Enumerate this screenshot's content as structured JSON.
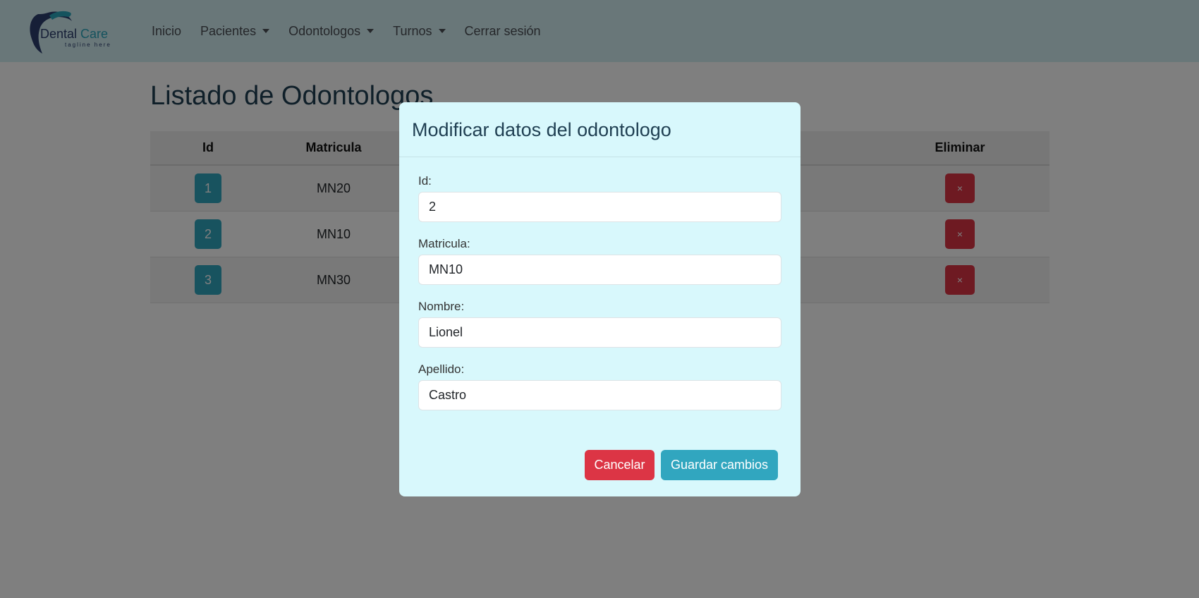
{
  "brand": {
    "name_part1": "Dental",
    "name_part2": "Care",
    "tagline": "tagline here"
  },
  "nav": {
    "items": [
      {
        "label": "Inicio",
        "dropdown": false
      },
      {
        "label": "Pacientes",
        "dropdown": true
      },
      {
        "label": "Odontologos",
        "dropdown": true
      },
      {
        "label": "Turnos",
        "dropdown": true
      },
      {
        "label": "Cerrar sesión",
        "dropdown": false
      }
    ]
  },
  "page": {
    "title": "Listado de Odontologos"
  },
  "table": {
    "headers": {
      "id": "Id",
      "matricula": "Matricula",
      "eliminar": "Eliminar"
    },
    "rows": [
      {
        "id": "1",
        "matricula": "MN20",
        "delete_symbol": "×"
      },
      {
        "id": "2",
        "matricula": "MN10",
        "delete_symbol": "×"
      },
      {
        "id": "3",
        "matricula": "MN30",
        "delete_symbol": "×"
      }
    ]
  },
  "modal": {
    "title": "Modificar datos del odontologo",
    "fields": {
      "id": {
        "label": "Id:",
        "value": "2"
      },
      "matricula": {
        "label": "Matricula:",
        "value": "MN10"
      },
      "nombre": {
        "label": "Nombre:",
        "value": "Lionel"
      },
      "apellido": {
        "label": "Apellido:",
        "value": "Castro"
      }
    },
    "cancel_label": "Cancelar",
    "save_label": "Guardar cambios"
  },
  "colors": {
    "navbar_bg": "#d3eef2",
    "modal_bg": "#d8f8fc",
    "primary": "#31a6bf",
    "danger": "#dc3545",
    "title": "#1f3f52"
  }
}
